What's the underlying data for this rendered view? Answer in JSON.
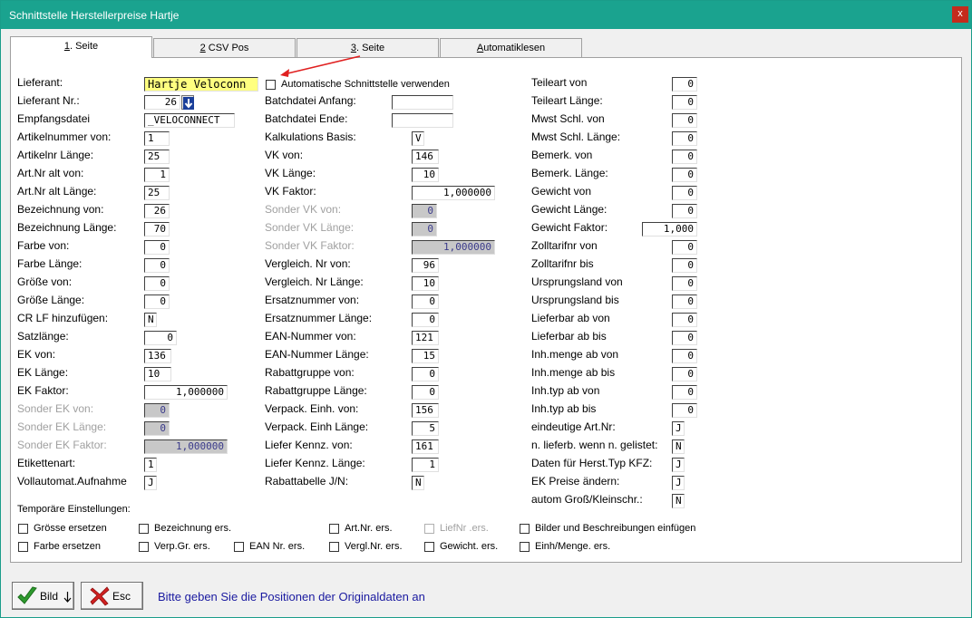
{
  "window": {
    "title": "Schnittstelle Herstellerpreise Hartje",
    "close_label": "x"
  },
  "tabs": [
    {
      "prefix": "",
      "accel": "1",
      "rest": ". Seite"
    },
    {
      "prefix": "",
      "accel": "2",
      "rest": " CSV Pos"
    },
    {
      "prefix": "",
      "accel": "3",
      "rest": ". Seite"
    },
    {
      "prefix": "",
      "accel": "A",
      "rest": "utomatiklesen"
    }
  ],
  "col1": [
    {
      "label": "Lieferant:",
      "value": "Hartje Veloconn"
    },
    {
      "label": "Lieferant Nr.:",
      "value": "26"
    },
    {
      "label": "Empfangsdatei",
      "value": "_VELOCONNECT"
    },
    {
      "label": "Artikelnummer von:",
      "value": "1"
    },
    {
      "label": "Artikelnr Länge:",
      "value": "25"
    },
    {
      "label": "Art.Nr alt von:",
      "value": "1"
    },
    {
      "label": "Art.Nr alt Länge:",
      "value": "25"
    },
    {
      "label": "Bezeichnung   von:",
      "value": "26"
    },
    {
      "label": "Bezeichnung Länge:",
      "value": "70"
    },
    {
      "label": "Farbe von:",
      "value": "0"
    },
    {
      "label": "Farbe Länge:",
      "value": "0"
    },
    {
      "label": "Größe von:",
      "value": "0"
    },
    {
      "label": "Größe Länge:",
      "value": "0"
    },
    {
      "label": "CR LF hinzufügen:",
      "value": "N"
    },
    {
      "label": "Satzlänge:",
      "value": "0"
    },
    {
      "label": "EK von:",
      "value": "136"
    },
    {
      "label": "EK Länge:",
      "value": "10"
    },
    {
      "label": "EK Faktor:",
      "value": "1,000000"
    },
    {
      "label": "Sonder EK von:",
      "value": "0"
    },
    {
      "label": "Sonder EK Länge:",
      "value": "0"
    },
    {
      "label": "Sonder EK Faktor:",
      "value": "1,000000"
    },
    {
      "label": "Etikettenart:",
      "value": "1"
    },
    {
      "label": "Vollautomat.Aufnahme",
      "value": "J"
    }
  ],
  "col2": [
    {
      "label": "Automatische Schnittstelle verwenden",
      "value": ""
    },
    {
      "label": "Batchdatei Anfang:",
      "value": ""
    },
    {
      "label": "Batchdatei Ende:",
      "value": ""
    },
    {
      "label": "Kalkulations Basis:",
      "value": "V"
    },
    {
      "label": "VK von:",
      "value": "146"
    },
    {
      "label": "VK Länge:",
      "value": "10"
    },
    {
      "label": "VK Faktor:",
      "value": "1,000000"
    },
    {
      "label": "Sonder VK von:",
      "value": "0"
    },
    {
      "label": "Sonder VK Länge:",
      "value": "0"
    },
    {
      "label": "Sonder VK Faktor:",
      "value": "1,000000"
    },
    {
      "label": "Vergleich. Nr von:",
      "value": "96"
    },
    {
      "label": "Vergleich. Nr Länge:",
      "value": "10"
    },
    {
      "label": "Ersatznummer   von:",
      "value": "0"
    },
    {
      "label": "Ersatznummer Länge:",
      "value": "0"
    },
    {
      "label": "EAN-Nummer     von:",
      "value": "121"
    },
    {
      "label": "EAN-Nummer   Länge:",
      "value": "15"
    },
    {
      "label": "Rabattgruppe   von:",
      "value": "0"
    },
    {
      "label": "Rabattgruppe  Länge:",
      "value": "0"
    },
    {
      "label": "Verpack. Einh. von:",
      "value": "156"
    },
    {
      "label": "Verpack. Einh Länge:",
      "value": "5"
    },
    {
      "label": "Liefer Kennz. von:",
      "value": "161"
    },
    {
      "label": "Liefer Kennz. Länge:",
      "value": "1"
    },
    {
      "label": "Rabattabelle J/N:",
      "value": "N"
    }
  ],
  "col3": [
    {
      "label": "Teileart von",
      "value": "0"
    },
    {
      "label": "Teileart Länge:",
      "value": "0"
    },
    {
      "label": "Mwst Schl. von",
      "value": "0"
    },
    {
      "label": "Mwst Schl. Länge:",
      "value": "0"
    },
    {
      "label": "Bemerk. von",
      "value": "0"
    },
    {
      "label": "Bemerk. Länge:",
      "value": "0"
    },
    {
      "label": "Gewicht von",
      "value": "0"
    },
    {
      "label": "Gewicht Länge:",
      "value": "0"
    },
    {
      "label": "Gewicht Faktor:",
      "value": "1,000"
    },
    {
      "label": "Zolltarifnr von",
      "value": "0"
    },
    {
      "label": "Zolltarifnr bis",
      "value": "0"
    },
    {
      "label": "Ursprungsland von",
      "value": "0"
    },
    {
      "label": "Ursprungsland bis",
      "value": "0"
    },
    {
      "label": "Lieferbar ab von",
      "value": "0"
    },
    {
      "label": "Lieferbar ab bis",
      "value": "0"
    },
    {
      "label": "Inh.menge ab von",
      "value": "0"
    },
    {
      "label": "Inh.menge ab bis",
      "value": "0"
    },
    {
      "label": "Inh.typ ab von",
      "value": "0"
    },
    {
      "label": "Inh.typ ab bis",
      "value": "0"
    },
    {
      "label": "eindeutige Art.Nr:",
      "value": "J"
    },
    {
      "label": "n. lieferb. wenn n. gelistet:",
      "value": "N"
    },
    {
      "label": "Daten für Herst.Typ KFZ:",
      "value": "J"
    },
    {
      "label": "EK Preise ändern:",
      "value": "J"
    },
    {
      "label": "autom Groß/Kleinschr.:",
      "value": "N"
    }
  ],
  "temp": {
    "heading": "Temporäre Einstellungen:",
    "row1": [
      "Grösse ersetzen",
      "Bezeichnung ers.",
      "Art.Nr. ers.",
      "LiefNr   .ers.",
      "Bilder und Beschreibungen einfügen"
    ],
    "row2": [
      "Farbe ersetzen",
      "Verp.Gr. ers.",
      "EAN Nr. ers.",
      "Vergl.Nr. ers.",
      "Gewicht. ers.",
      "Einh/Menge. ers."
    ]
  },
  "buttons": {
    "bild": "Bild",
    "esc": "Esc"
  },
  "status": "Bitte geben Sie die Positionen der Originaldaten an",
  "colors": {
    "titlebar": "#1aa38f",
    "close": "#c42b1c",
    "status_text": "#1a1aa0",
    "highlight_field": "#ffff80"
  }
}
